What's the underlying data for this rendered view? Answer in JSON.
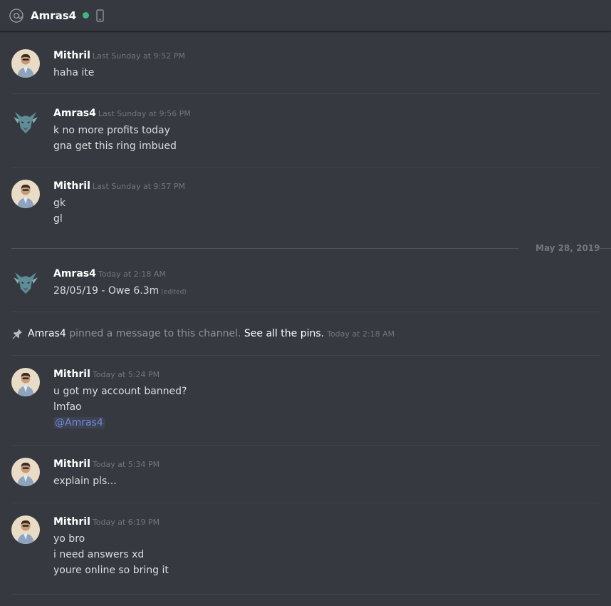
{
  "header": {
    "channel_name": "Amras4",
    "status": "online",
    "device": "mobile",
    "colors": {
      "online": "#43b581"
    }
  },
  "messages": [
    {
      "author": "Mithril",
      "timestamp": "Last Sunday at 9:52 PM",
      "avatar": "mithril-avatar",
      "lines": [
        "haha ite"
      ]
    },
    {
      "author": "Amras4",
      "timestamp": "Last Sunday at 9:56 PM",
      "avatar": "dragon-avatar",
      "lines": [
        "k no more profits today",
        "gna get this ring imbued"
      ]
    },
    {
      "author": "Mithril",
      "timestamp": "Last Sunday at 9:57 PM",
      "avatar": "mithril-avatar",
      "lines": [
        "gk",
        "gl"
      ]
    },
    {
      "author": "Amras4",
      "timestamp": "Today at 2:18 AM",
      "avatar": "dragon-avatar",
      "lines": [
        "28/05/19 - Owe 6.3m"
      ],
      "edited": "(edited)"
    },
    {
      "author": "Mithril",
      "timestamp": "Today at 5:24 PM",
      "avatar": "mithril-avatar",
      "lines": [
        "u got my account banned?",
        "lmfao"
      ],
      "mention": "@Amras4"
    },
    {
      "author": "Mithril",
      "timestamp": "Today at 5:34 PM",
      "avatar": "mithril-avatar",
      "lines": [
        "explain pls..."
      ]
    },
    {
      "author": "Mithril",
      "timestamp": "Today at 6:19 PM",
      "avatar": "mithril-avatar",
      "lines": [
        "yo bro",
        "i need answers xd",
        "youre online so bring it"
      ]
    }
  ],
  "date_separator": "May 28, 2019",
  "system_message": {
    "actor": "Amras4",
    "text": " pinned a message to this channel. ",
    "link": "See all the pins.",
    "timestamp": "Today at 2:18 AM"
  }
}
